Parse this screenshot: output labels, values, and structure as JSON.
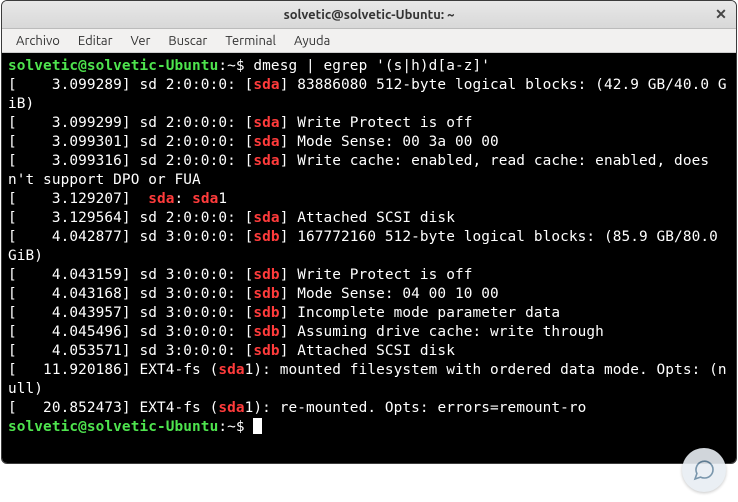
{
  "titlebar": {
    "title": "solvetic@solvetic-Ubuntu: ~"
  },
  "menubar": {
    "items": [
      "Archivo",
      "Editar",
      "Ver",
      "Buscar",
      "Terminal",
      "Ayuda"
    ]
  },
  "prompt": {
    "userhost": "solvetic@solvetic-Ubuntu",
    "sep": ":",
    "cwd": "~",
    "sym": "$"
  },
  "command": "dmesg | egrep '(s|h)d[a-z]'",
  "lines": [
    "[    3.099289] sd 2:0:0:0: [sda] 83886080 512-byte logical blocks: (42.9 GB/40.0 GiB)",
    "[    3.099299] sd 2:0:0:0: [sda] Write Protect is off",
    "[    3.099301] sd 2:0:0:0: [sda] Mode Sense: 00 3a 00 00",
    "[    3.099316] sd 2:0:0:0: [sda] Write cache: enabled, read cache: enabled, doesn't support DPO or FUA",
    "[    3.129207]  sda: sda1",
    "[    3.129564] sd 2:0:0:0: [sda] Attached SCSI disk",
    "[    4.042877] sd 3:0:0:0: [sdb] 167772160 512-byte logical blocks: (85.9 GB/80.0 GiB)",
    "[    4.043159] sd 3:0:0:0: [sdb] Write Protect is off",
    "[    4.043168] sd 3:0:0:0: [sdb] Mode Sense: 04 00 10 00",
    "[    4.043957] sd 3:0:0:0: [sdb] Incomplete mode parameter data",
    "[    4.045496] sd 3:0:0:0: [sdb] Assuming drive cache: write through",
    "[    4.053571] sd 3:0:0:0: [sdb] Attached SCSI disk",
    "[   11.920186] EXT4-fs (sda1): mounted filesystem with ordered data mode. Opts: (null)",
    "[   20.852473] EXT4-fs (sda1): re-mounted. Opts: errors=remount-ro"
  ],
  "highlight_tokens": [
    "sda",
    "sdb"
  ]
}
